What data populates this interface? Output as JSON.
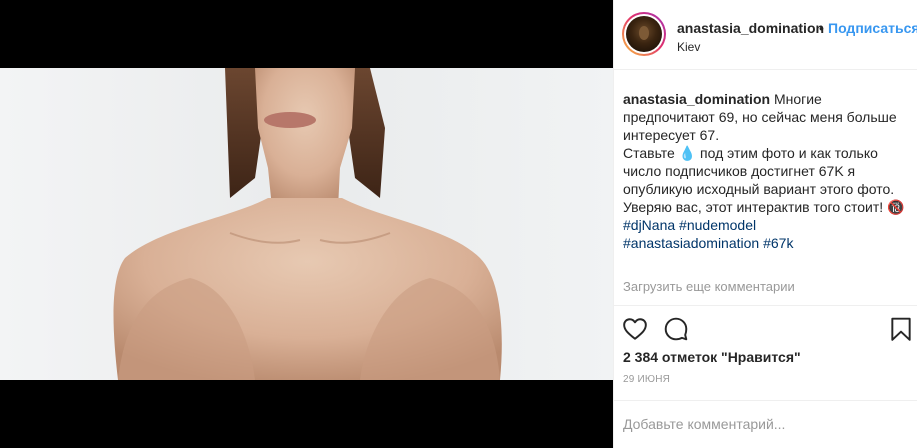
{
  "post": {
    "media_alt": "photo",
    "username": "anastasia_domination",
    "separator": "•",
    "follow_label": "Подписаться",
    "location": "Kiev"
  },
  "caption": {
    "username": "anastasia_domination",
    "text_1": "Многие предпочитают 69, но сейчас меня больше интересует 67.",
    "text_2a": "Ставьте ",
    "drop_emoji": "💧",
    "text_2b": " под этим фото и как только число подписчиков достигнет 67K я опубликую исходный вариант этого фото. Уверяю вас, этот интерактив того стоит! ",
    "emoji_end": "🔞",
    "hashtags_line1": [
      "#djNana",
      "#nudemodel"
    ],
    "hashtags_line2": [
      "#anastasiadomination",
      "#67k"
    ]
  },
  "comments": {
    "load_more": "Загрузить еще комментарии"
  },
  "actions": {
    "like_icon": "heart-outline-icon",
    "comment_icon": "comment-bubble-icon",
    "bookmark_icon": "bookmark-outline-icon"
  },
  "stats": {
    "likes": "2 384 отметок \"Нравится\"",
    "date": "29 ИЮНЯ"
  },
  "comment_box": {
    "placeholder": "Добавьте комментарий..."
  },
  "colors": {
    "link": "#003569",
    "follow": "#3897f0",
    "text": "#262626",
    "muted": "#999999"
  }
}
